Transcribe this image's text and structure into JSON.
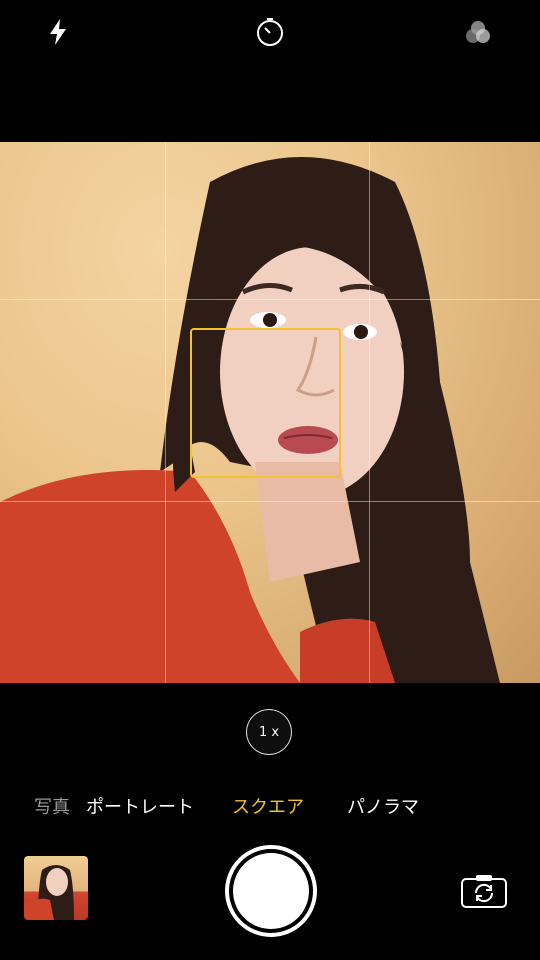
{
  "top_bar": {
    "icons": [
      "flash-icon",
      "timer-icon",
      "filters-icon"
    ]
  },
  "viewfinder": {
    "grid": true,
    "focus_box_color": "#f2c230"
  },
  "zoom": {
    "label": "1 x"
  },
  "modes": {
    "items": [
      "写真",
      "ポートレート",
      "スクエア",
      "パノラマ"
    ],
    "active": "スクエア"
  },
  "controls": {
    "thumbnail_icon": "last-photo-thumbnail",
    "shutter_icon": "shutter-button",
    "switch_icon": "switch-camera-icon"
  },
  "colors": {
    "accent": "#f2c230",
    "background": "#000000"
  }
}
